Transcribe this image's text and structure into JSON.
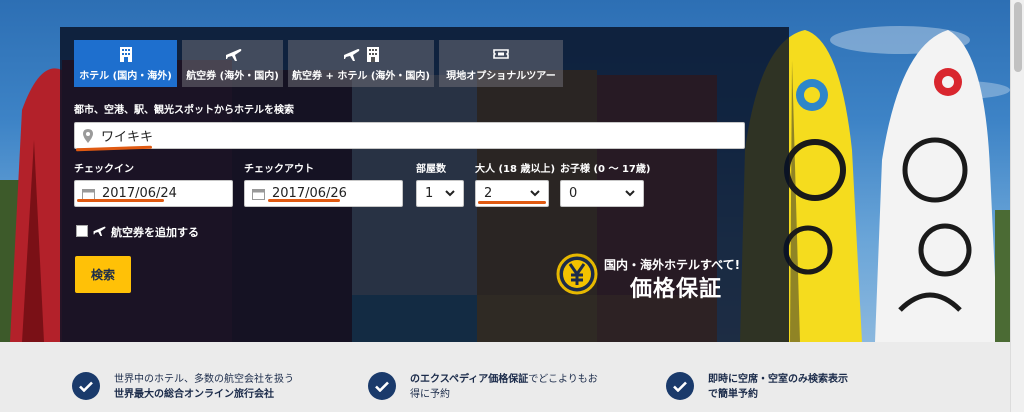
{
  "tabs": [
    {
      "label": "ホテル (国内・海外)",
      "icons": [
        "hotel-icon"
      ],
      "active": true
    },
    {
      "label": "航空券 (海外・国内)",
      "icons": [
        "plane-icon"
      ],
      "active": false
    },
    {
      "label": "航空券 + ホテル (海外・国内)",
      "icons": [
        "plane-icon",
        "hotel-icon"
      ],
      "active": false
    },
    {
      "label": "現地オプショナルツアー",
      "icons": [
        "ticket-icon"
      ],
      "active": false
    }
  ],
  "destination": {
    "label": "都市、空港、駅、観光スポットからホテルを検索",
    "value": "ワイキキ",
    "icon": "location-pin-icon"
  },
  "checkin": {
    "label": "チェックイン",
    "value": "2017/06/24",
    "icon": "calendar-icon"
  },
  "checkout": {
    "label": "チェックアウト",
    "value": "2017/06/26",
    "icon": "calendar-icon"
  },
  "rooms": {
    "label": "部屋数",
    "value": "1"
  },
  "adults": {
    "label": "大人 (18 歳以上)",
    "value": "2"
  },
  "children": {
    "label": "お子様 (0 ～ 17歳)",
    "value": "0"
  },
  "add_flight": {
    "label": "航空券を追加する",
    "checked": false,
    "icon": "plane-icon"
  },
  "search_button": "検索",
  "guarantee": {
    "line1": "国内・海外ホテルすべて!",
    "line2": "価格保証",
    "icon": "yen-badge-icon"
  },
  "features": [
    {
      "line1": "世界中のホテル、多数の航空会社を扱う",
      "line2": "世界最大の総合オンライン旅行会社"
    },
    {
      "line1_bold": "のエクスペディア価格保証",
      "line1_rest": "でどこよりもお",
      "line2": "得に予約"
    },
    {
      "line1": "即時に空席・空室のみ検索表示",
      "line2": "で簡単予約"
    }
  ],
  "colors": {
    "panel": "#0a1428",
    "active_tab": "#1e6fce",
    "search_button": "#ffc107",
    "annotation_underline": "#e05a12",
    "check_circle": "#1a3a6b"
  }
}
